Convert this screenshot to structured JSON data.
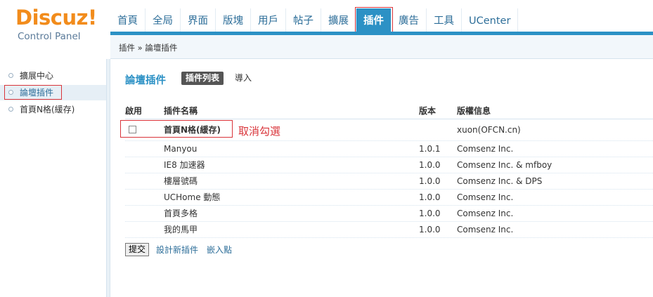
{
  "logo": {
    "brand": "Discuz!",
    "subtitle": "Control Panel"
  },
  "nav": {
    "items": [
      "首頁",
      "全局",
      "界面",
      "版塊",
      "用戶",
      "帖子",
      "擴展",
      "插件",
      "廣告",
      "工具",
      "UCenter"
    ],
    "active": "插件"
  },
  "breadcrumb": "插件 » 論壇插件",
  "sidebar": {
    "items": [
      "擴展中心",
      "論壇插件",
      "首頁N格(緩存)"
    ],
    "active": "論壇插件"
  },
  "main": {
    "title": "論壇插件",
    "tab_active": "插件列表",
    "tab_link": "導入"
  },
  "table": {
    "headers": [
      "啟用",
      "插件名稱",
      "版本",
      "版權信息"
    ],
    "rows": [
      {
        "enabled": false,
        "name": "首頁N格(緩存)",
        "version": "",
        "copyright": "xuon(OFCN.cn)"
      },
      {
        "name": "Manyou",
        "version": "1.0.1",
        "copyright": "Comsenz Inc."
      },
      {
        "name": "IE8 加速器",
        "version": "1.0.0",
        "copyright": "Comsenz Inc. & mfboy"
      },
      {
        "name": "樓層號碼",
        "version": "1.0.0",
        "copyright": "Comsenz Inc. & DPS"
      },
      {
        "name": "UCHome 動態",
        "version": "1.0.0",
        "copyright": "Comsenz Inc."
      },
      {
        "name": "首頁多格",
        "version": "1.0.0",
        "copyright": "Comsenz Inc."
      },
      {
        "name": "我的馬甲",
        "version": "1.0.0",
        "copyright": "Comsenz Inc."
      }
    ]
  },
  "annotation": "取消勾選",
  "footer": {
    "submit": "提交",
    "link_design": "設計新插件",
    "link_hook": "嵌入點"
  },
  "colors": {
    "accent": "#2c91c5",
    "logo": "#f28c1c",
    "highlight": "#d9343a"
  }
}
